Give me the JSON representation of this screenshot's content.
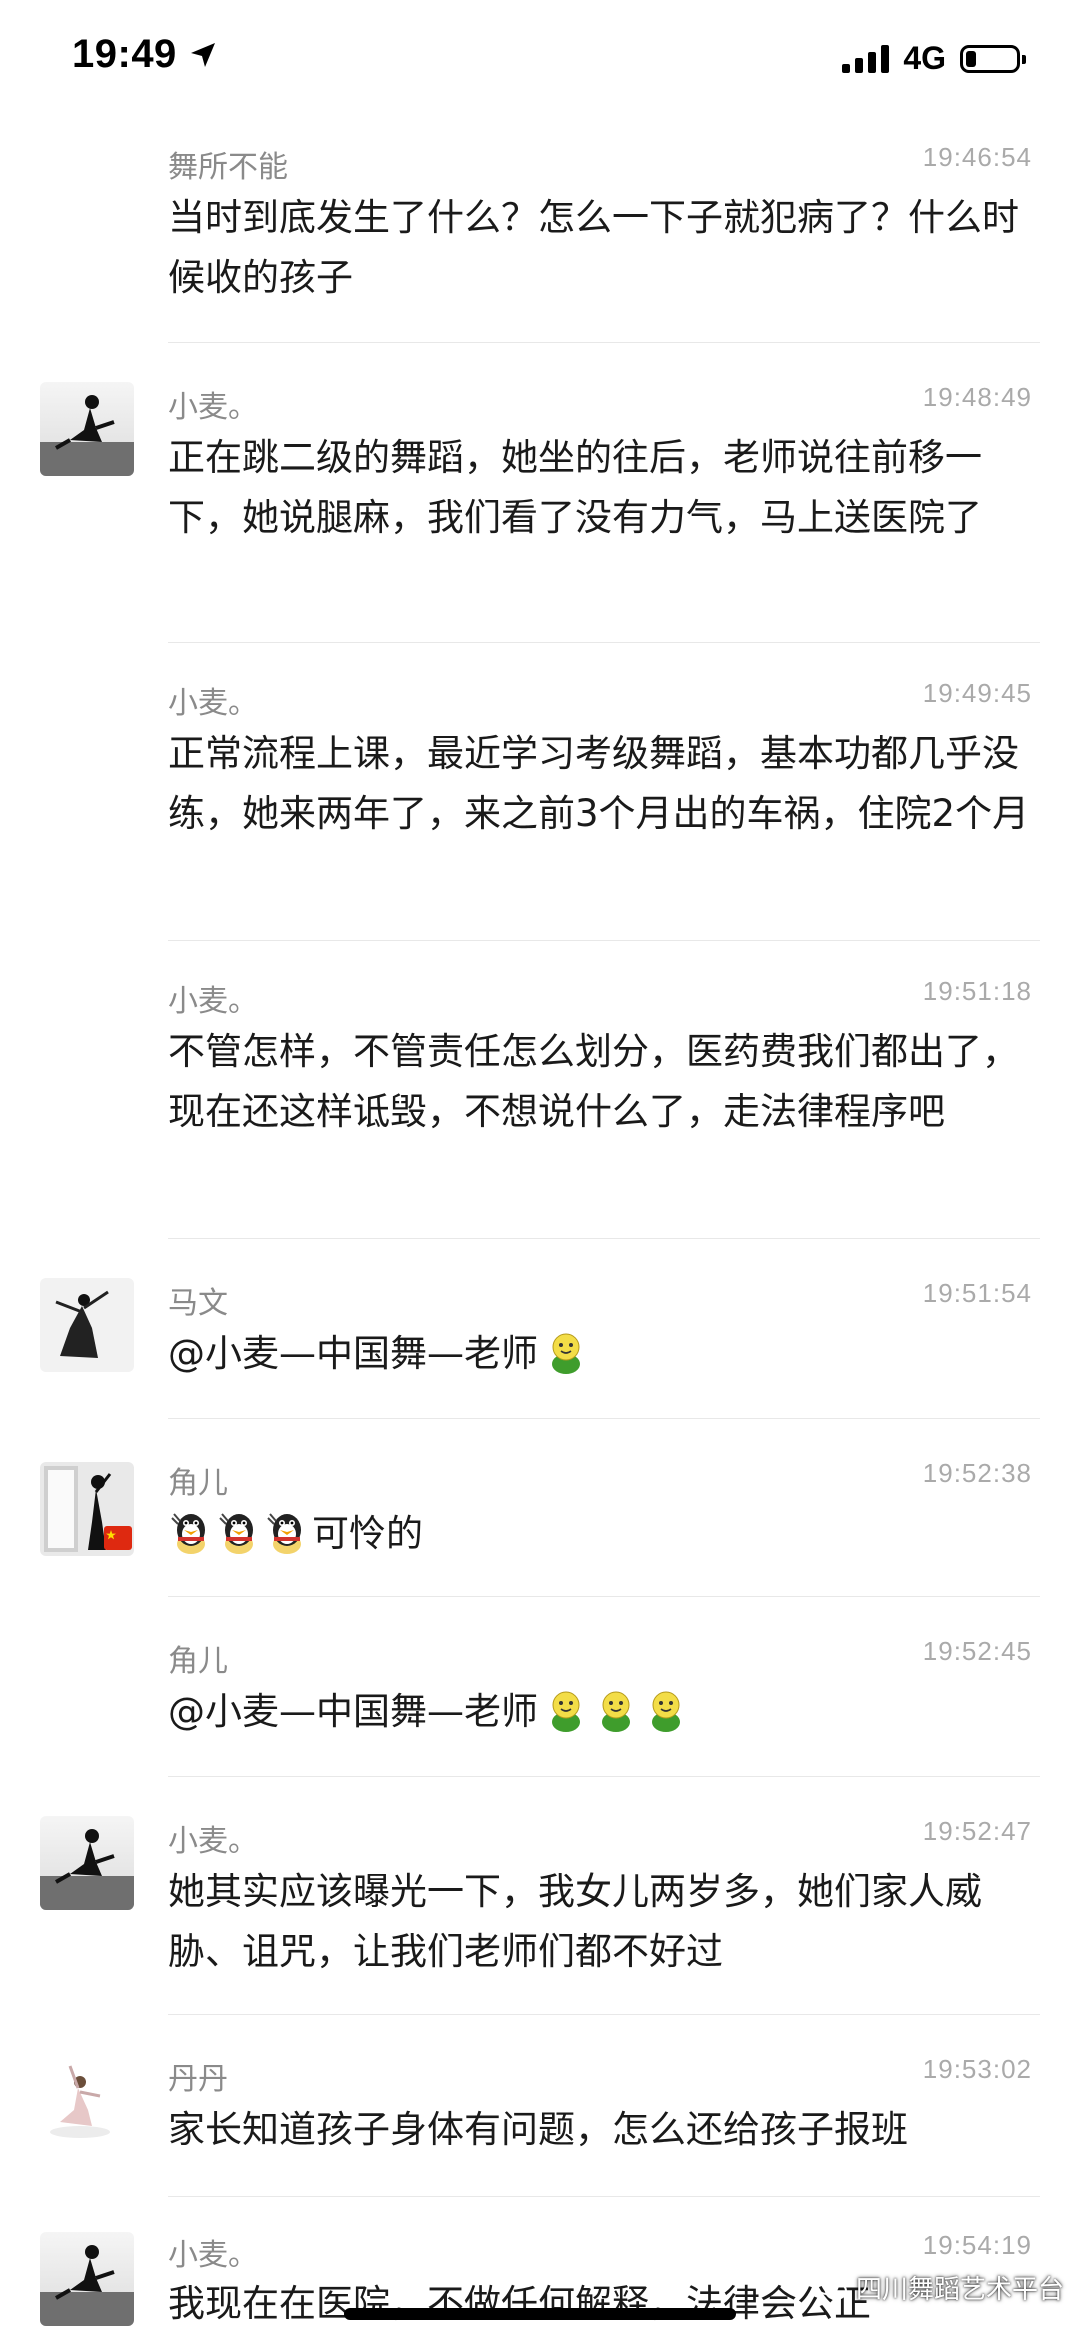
{
  "status_bar": {
    "time": "19:49",
    "network": "4G",
    "battery_level": 0.2,
    "signal_bars": 4
  },
  "messages": [
    {
      "sender": "舞所不能",
      "time": "19:46:54",
      "text": "当时到底发生了什么？怎么一下子就犯病了？什么时候收的孩子",
      "avatar": "none"
    },
    {
      "sender": "小麦。",
      "time": "19:48:49",
      "text": "正在跳二级的舞蹈，她坐的往后，老师说往前移一下，她说腿麻，我们看了没有力气，马上送医院了",
      "avatar": "dancer-sitting"
    },
    {
      "sender": "小麦。",
      "time": "19:49:45",
      "text": "正常流程上课，最近学习考级舞蹈，基本功都几乎没练，她来两年了，来之前3个月出的车祸，住院2个月",
      "avatar": "none"
    },
    {
      "sender": "小麦。",
      "time": "19:51:18",
      "text": "不管怎样，不管责任怎么划分，医药费我们都出了，现在还这样诋毁，不想说什么了，走法律程序吧",
      "avatar": "none"
    },
    {
      "sender": "马文",
      "time": "19:51:54",
      "text": "@小麦—中国舞—老师",
      "emoji_suffix": [
        "smile-emoji"
      ],
      "avatar": "dancer-dress"
    },
    {
      "sender": "角儿",
      "time": "19:52:38",
      "text": "可怜的",
      "emoji_prefix": [
        "qq-penguin-emoji",
        "qq-penguin-emoji",
        "qq-penguin-emoji"
      ],
      "avatar": "dancer-window"
    },
    {
      "sender": "角儿",
      "time": "19:52:45",
      "text": "@小麦—中国舞—老师",
      "emoji_suffix": [
        "smile-emoji",
        "smile-emoji",
        "smile-emoji"
      ],
      "avatar": "none"
    },
    {
      "sender": "小麦。",
      "time": "19:52:47",
      "text": "她其实应该曝光一下，我女儿两岁多，她们家人威胁、诅咒，让我们老师们都不好过",
      "avatar": "dancer-sitting"
    },
    {
      "sender": "丹丹",
      "time": "19:53:02",
      "text": "家长知道孩子身体有问题，怎么还给孩子报班",
      "avatar": "dancer-child"
    },
    {
      "sender": "小麦。",
      "time": "19:54:19",
      "text": "我现在在医院，不做任何解释，法律会公正",
      "avatar": "dancer-sitting"
    }
  ],
  "watermark": {
    "text": "四川舞蹈艺术平台",
    "icon": "wechat-icon"
  },
  "colors": {
    "sender": "#8a8a8a",
    "timestamp": "#aaaaaa",
    "divider": "#e8e8e8",
    "text": "#1a1a1a",
    "emoji_green": "#4caf3a",
    "emoji_yellow": "#f6e04a"
  }
}
